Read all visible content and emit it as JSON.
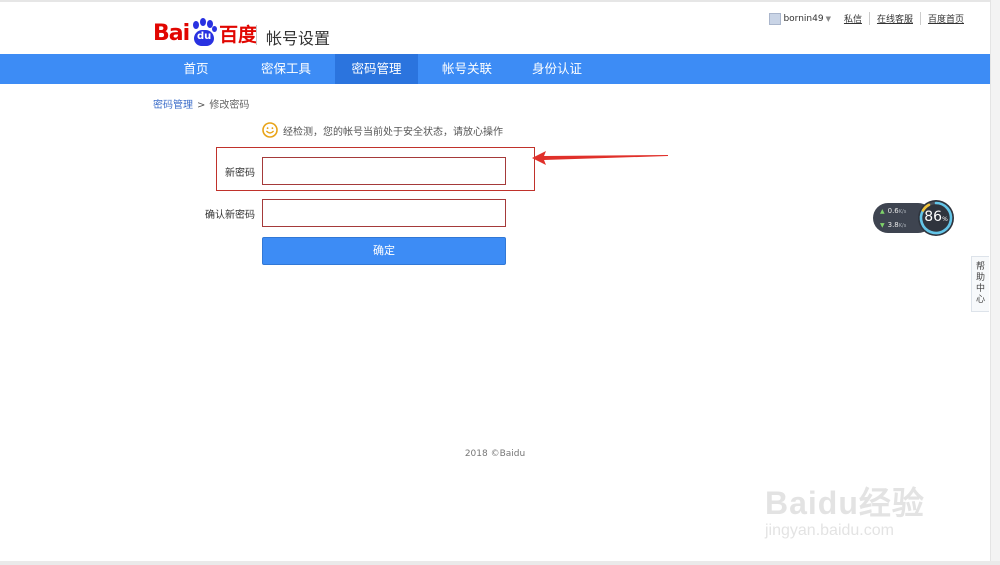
{
  "header": {
    "logo_text_latin": "Bai",
    "logo_text_paw": "du",
    "logo_text_cn": "百度",
    "app_title": "帐号设置",
    "user_name": "bornin49",
    "links": [
      "私信",
      "在线客服",
      "百度首页"
    ]
  },
  "nav": {
    "items": [
      {
        "label": "首页",
        "active": false
      },
      {
        "label": "密保工具",
        "active": false
      },
      {
        "label": "密码管理",
        "active": true
      },
      {
        "label": "帐号关联",
        "active": false
      },
      {
        "label": "身份认证",
        "active": false
      }
    ]
  },
  "breadcrumb": {
    "parent": "密码管理",
    "separator": ">",
    "current": "修改密码"
  },
  "notice": {
    "icon": "smile-icon",
    "text": "经检测，您的帐号当前处于安全状态，请放心操作"
  },
  "form": {
    "new_password_label": "新密码",
    "new_password_value": "",
    "confirm_password_label": "确认新密码",
    "confirm_password_value": "",
    "submit_label": "确定"
  },
  "speed_widget": {
    "upload": "0.6",
    "upload_unit": "K/s",
    "download": "3.8",
    "download_unit": "K/s",
    "percent": "86",
    "percent_unit": "%"
  },
  "help_tab": {
    "label": "帮助中心"
  },
  "footer": {
    "text": "2018 ©Baidu"
  },
  "watermark": {
    "brand": "Baidu经验",
    "url": "jingyan.baidu.com"
  },
  "colors": {
    "nav_bg": "#3d8cf5",
    "nav_active": "#2b74de",
    "brand_red": "#e10601",
    "brand_blue": "#2932e1",
    "input_border": "#a53a3a",
    "highlight_red": "#c0322b",
    "arrow_red": "#e0302a"
  }
}
